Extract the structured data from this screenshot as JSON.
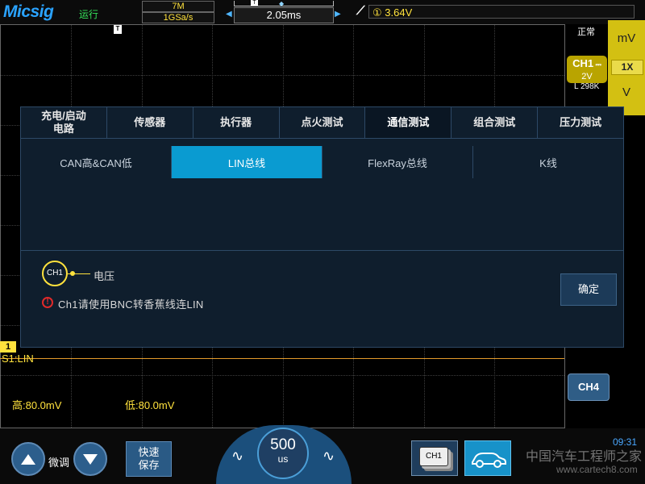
{
  "top": {
    "brand": "Micsig",
    "run_status": "运行",
    "mem_depth": "7M",
    "sample_rate": "1GSa/s",
    "time_offset": "2.05ms",
    "trigger_source_icon": "①",
    "trigger_level": "3.64V",
    "trigger_marker": "T"
  },
  "right_panel": {
    "mode": "正常",
    "unit_mv": "mV",
    "probe_ratio": "1X",
    "unit_v": "V",
    "ch1_badge": "CH1",
    "ch1_scale": "2V",
    "ch1_coupling_icon": "dc-coupling-icon",
    "record_length": "L 298K",
    "ch4_button": "CH4"
  },
  "screen": {
    "trigger_t_marker": "T",
    "ch1_marker": "1",
    "serial_label": "S1:LIN",
    "threshold_high": "高:80.0mV",
    "threshold_low": "低:80.0mV"
  },
  "dialog": {
    "main_tabs": [
      {
        "label": "充电/启动\n电路",
        "active": false
      },
      {
        "label": "传感器",
        "active": false
      },
      {
        "label": "执行器",
        "active": false
      },
      {
        "label": "点火测试",
        "active": false
      },
      {
        "label": "通信测试",
        "active": true
      },
      {
        "label": "组合测试",
        "active": false
      },
      {
        "label": "压力测试",
        "active": false
      }
    ],
    "sub_tabs": [
      {
        "label": "CAN高&CAN低",
        "active": false
      },
      {
        "label": "LIN总线",
        "active": true
      },
      {
        "label": "FlexRay总线",
        "active": false
      },
      {
        "label": "K线",
        "active": false
      }
    ],
    "probe_channel": "CH1",
    "probe_label": "电压",
    "warning_text": "Ch1请使用BNC转香蕉线连LIN",
    "confirm_button": "确定"
  },
  "bottom": {
    "fine_adjust": "微调",
    "quick_save": "快速\n保存",
    "timebase_value": "500",
    "timebase_unit": "us",
    "ch1_stack": "CH1",
    "clock": "09:31",
    "watermark": "中国汽车工程师之家",
    "watermark_url": "www.cartech8.com"
  },
  "colors": {
    "ch1_yellow": "#ffe23d",
    "accent_blue": "#0a9bd1",
    "dialog_bg": "#0f1e2d",
    "serial_line": "#e49b2c"
  }
}
